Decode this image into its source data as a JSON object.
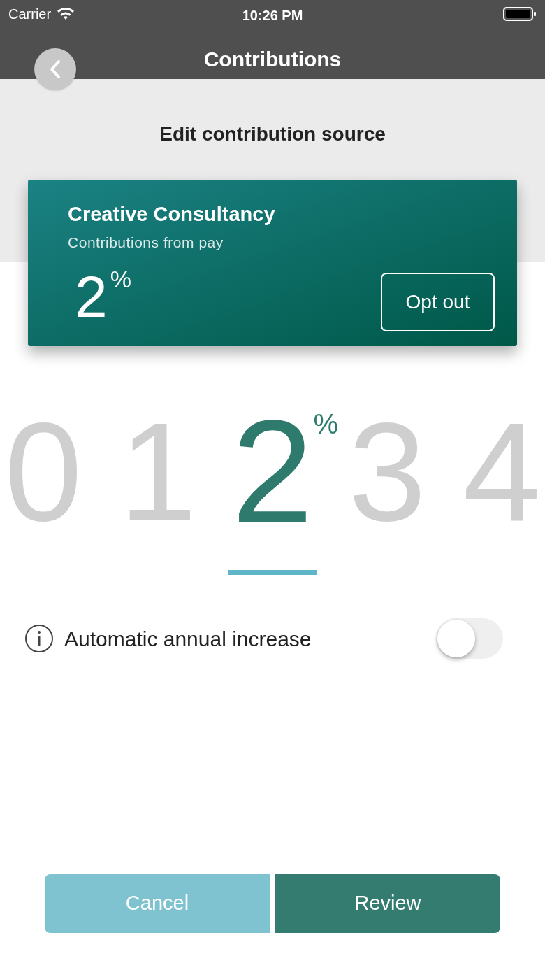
{
  "status_bar": {
    "carrier": "Carrier",
    "time": "10:26 PM"
  },
  "nav": {
    "title": "Contributions"
  },
  "heading": "Edit contribution source",
  "card": {
    "name": "Creative Consultancy",
    "subtitle": "Contributions from pay",
    "value": "2",
    "unit": "%",
    "button": "Opt out"
  },
  "picker": {
    "unit": "%",
    "items": [
      {
        "label": "0",
        "selected": false
      },
      {
        "label": "1",
        "selected": false
      },
      {
        "label": "2",
        "selected": true
      },
      {
        "label": "3",
        "selected": false
      },
      {
        "label": "4",
        "selected": false
      }
    ]
  },
  "auto_increase": {
    "label": "Automatic annual increase",
    "on": false
  },
  "buttons": [
    {
      "label": "Cancel",
      "kind": "secondary"
    },
    {
      "label": "Review",
      "kind": "primary"
    }
  ]
}
